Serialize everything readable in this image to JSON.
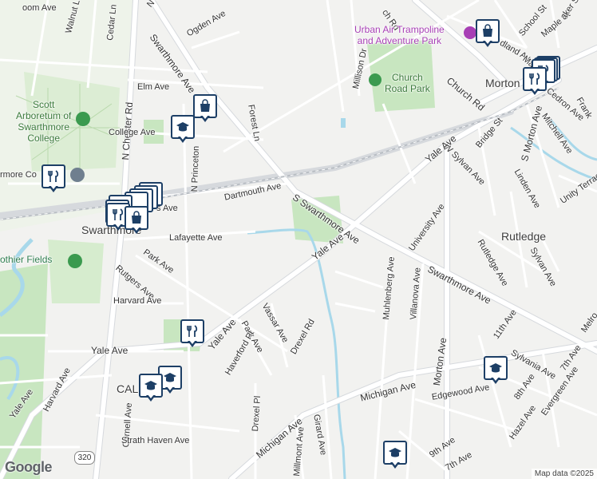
{
  "map": {
    "colors": {
      "road": "#ffffff",
      "road_edge": "#d6d9dd",
      "park": "#c8e6c0",
      "water": "#a8d8ea",
      "rail": "#b9bec4",
      "pin_border": "#1d3f66",
      "poi_green": "#3b7a3b",
      "poi_purple": "#a73fb5"
    },
    "labels": {
      "walnut_ln": "Walnut Ln",
      "cedar_ln": "Cedar Ln",
      "n_chester_top": "N Ches",
      "ogden_ave": "Ogden Ave",
      "church_rd_top": "ch Rd",
      "school_st": "School St",
      "maple_st": "Maple St",
      "walker_st": "aker St",
      "oakland_ave": "dland Av",
      "swarthmore_ave_n": "Swarthmore Ave",
      "millison_dr": "Millison Dr",
      "elm_ave": "Elm Ave",
      "forest_ln": "Forest Ln",
      "n_chester_rd": "N Chester Rd",
      "college_ave": "College Ave",
      "n_princeton": "N Princeton",
      "church_rd": "Church Rd",
      "main_st": "Main",
      "cedron_ave": "Cedron Ave",
      "mitchell_ave": "Mitchell Ave",
      "frank": "Frank",
      "morton": "Morton",
      "bridge_st": "Bridge St",
      "w_sylvan_ave": "W Sylvan Ave",
      "s_morton_ave": "S Morton Ave",
      "linden_ave": "Linden Ave",
      "unity_terrace": "Unity Terrac",
      "yale_ave_ne": "Yale Ave",
      "dartmouth_ave": "Dartmouth Ave",
      "s_swarthmore_ave": "S Swarthmore Ave",
      "university_ave": "University Ave",
      "rutledge": "Rutledge",
      "rutledge_ave": "Rutledge Ave",
      "sylvan_ave": "Sylvan Ave",
      "lafayette_ave": "Lafayette Ave",
      "yale_ave_mid": "Yale Ave",
      "park_ave": "Park Ave",
      "muhlenberg_ave": "Muhlenberg Ave",
      "villanova_ave": "Villanova Ave",
      "swarthmore_ave_se": "Swarthmore Ave",
      "rutgers_ave": "Rutgers Ave",
      "harvard_ave": "Harvard Ave",
      "vassar_ave": "Vassar Ave",
      "park_ave_2": "Park Ave",
      "yale_ave_sw": "Yale Ave",
      "haverford_pl": "Haverford Pl",
      "drexel_rd": "Drexel Rd",
      "morton_ave": "Morton Ave",
      "ave_11th": "11th Ave",
      "melrose": "Melro",
      "sylvania_ave": "Sylvania Ave",
      "ave_7th_e": "7th Ave",
      "yale_ave_w": "Yale Ave",
      "michigan_ave": "Michigan Ave",
      "ave_8th": "8th Ave",
      "evergreen_ave": "Evergreen Ave",
      "yale_ave_far": "Yale Ave",
      "harvard_ave_w": "Harvard Ave",
      "cal": "CAL",
      "edgewood_ave": "Edgewood Ave",
      "hazel_ave": "Hazel Ave",
      "drexel_pl": "Drexel Pl",
      "cornell_ave": "Cornell Ave",
      "michigan_ave_s": "Michigan Ave",
      "girard_ave": "Girard Ave",
      "route_320": "320",
      "strath_haven": "Strath Haven Ave",
      "ave_9th": "9th Ave",
      "millmont_ave": "Millmont Ave",
      "ave_7th_s": "7th Ave",
      "oom_ave": "oom Ave",
      "s_ave": "s Ave",
      "swarthmore_co": "rmore Co",
      "rothier_fields": "othier Fields",
      "swarthmore_town": "Swarthmore"
    },
    "pois": {
      "urban_air": "Urban Air Trampoline\nand Adventure Park",
      "church_road_park": "Church\nRoad Park",
      "scott_arboretum": "Scott\nArboretum of\nSwarthmore\nCollege"
    },
    "pins": [
      {
        "name": "shopping-bag-icon",
        "type": "shopping"
      },
      {
        "name": "restaurant-icon",
        "type": "restaurant"
      },
      {
        "name": "graduation-cap-icon",
        "type": "school"
      }
    ],
    "branding": {
      "logo": "Google",
      "attribution": "Map data ©2025"
    }
  }
}
